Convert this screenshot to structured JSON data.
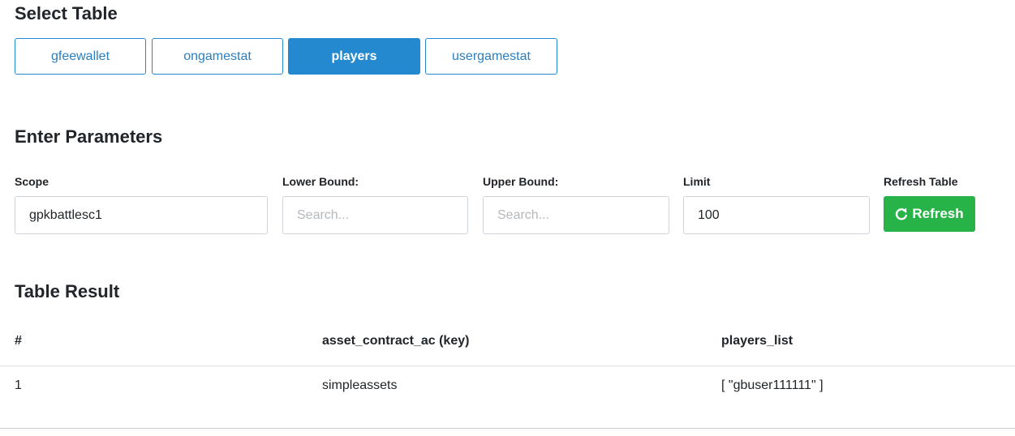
{
  "select_table": {
    "heading": "Select Table",
    "tabs": [
      {
        "label": "gfeewallet",
        "active": false
      },
      {
        "label": "ongamestat",
        "active": false
      },
      {
        "label": "players",
        "active": true
      },
      {
        "label": "usergamestat",
        "active": false
      }
    ]
  },
  "parameters": {
    "heading": "Enter Parameters",
    "scope": {
      "label": "Scope",
      "value": "gpkbattlesc1"
    },
    "lower_bound": {
      "label": "Lower Bound:",
      "value": "",
      "placeholder": "Search..."
    },
    "upper_bound": {
      "label": "Upper Bound:",
      "value": "",
      "placeholder": "Search..."
    },
    "limit": {
      "label": "Limit",
      "value": "100"
    },
    "refresh": {
      "label": "Refresh Table",
      "button_label": "Refresh",
      "icon": "refresh-icon"
    }
  },
  "result": {
    "heading": "Table Result",
    "columns": [
      "#",
      "asset_contract_ac (key)",
      "players_list"
    ],
    "rows": [
      [
        "1",
        "simpleassets",
        "[ \"gbuser111111\" ]"
      ]
    ]
  },
  "colors": {
    "primary": "#2589d0",
    "success": "#27b348"
  }
}
